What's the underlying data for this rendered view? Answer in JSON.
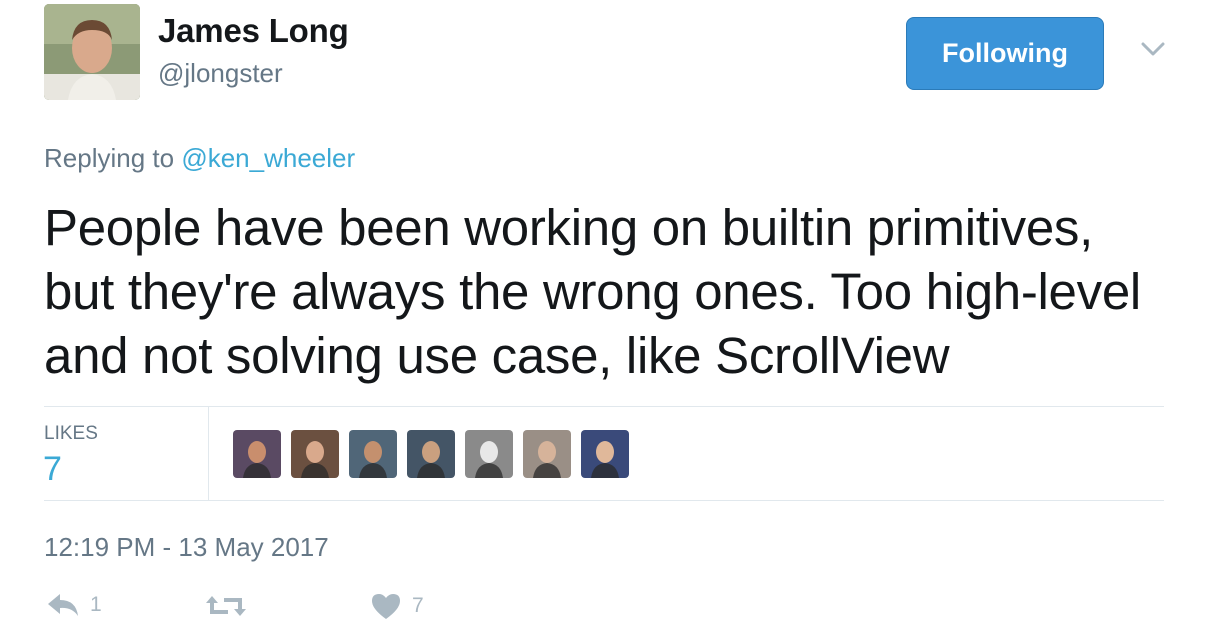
{
  "author": {
    "name": "James Long",
    "handle": "@jlongster"
  },
  "follow_button": {
    "label": "Following"
  },
  "reply_context": {
    "prefix": "Replying to",
    "mention": "@ken_wheeler"
  },
  "tweet": {
    "text": "People have been working on builtin primitives, but they're always the wrong ones. Too high-level and not solving use case, like ScrollView"
  },
  "stats": {
    "likes_label": "LIKES",
    "likes_count": "7",
    "likers": [
      {
        "name": "liker-1",
        "color": "#5a4a63"
      },
      {
        "name": "liker-2",
        "color": "#6b5040"
      },
      {
        "name": "liker-3",
        "color": "#506678"
      },
      {
        "name": "liker-4",
        "color": "#445566"
      },
      {
        "name": "liker-5",
        "color": "#8a8a8a"
      },
      {
        "name": "liker-6",
        "color": "#9a8f86"
      },
      {
        "name": "liker-7",
        "color": "#3a4a7a"
      }
    ]
  },
  "timestamp": "12:19 PM - 13 May 2017",
  "actions": {
    "reply": {
      "icon": "reply-icon",
      "count": "1"
    },
    "retweet": {
      "icon": "retweet-icon",
      "count": ""
    },
    "like": {
      "icon": "heart-icon",
      "count": "7"
    }
  },
  "colors": {
    "accent": "#3b94d9",
    "link": "#3ba9d5",
    "muted": "#657786",
    "icon": "#aab8c2"
  }
}
